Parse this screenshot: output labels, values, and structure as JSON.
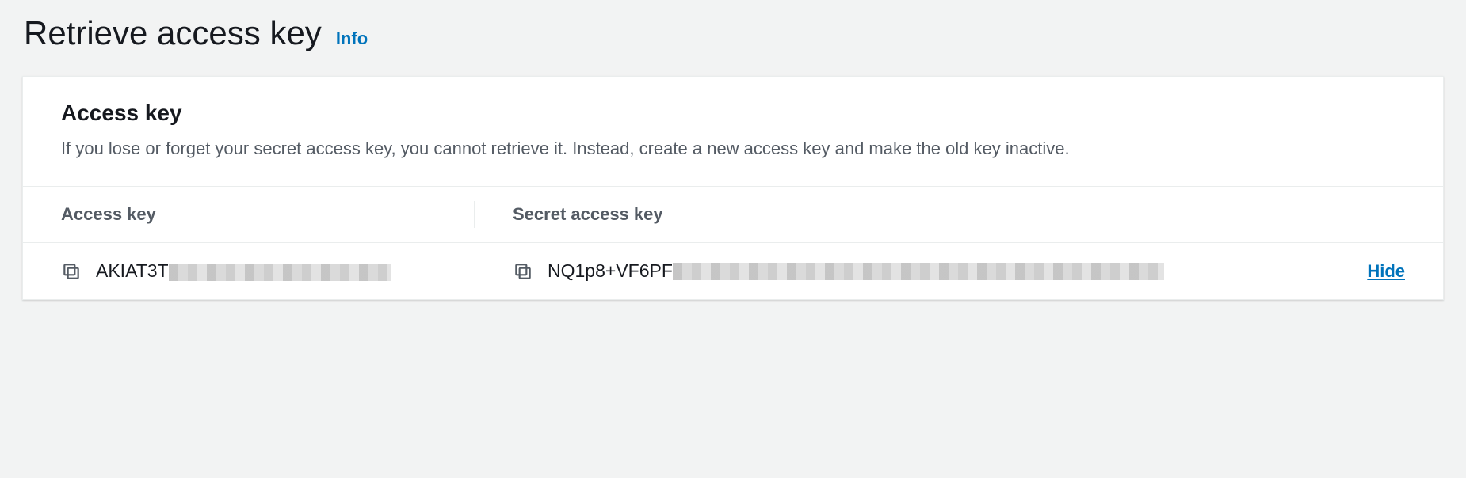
{
  "header": {
    "title": "Retrieve access key",
    "info_label": "Info"
  },
  "panel": {
    "title": "Access key",
    "description": "If you lose or forget your secret access key, you cannot retrieve it. Instead, create a new access key and make the old key inactive.",
    "columns": {
      "access_key": "Access key",
      "secret_key": "Secret access key"
    },
    "row": {
      "access_key_value": "AKIAT3T",
      "secret_key_value": "NQ1p8+VF6PF",
      "hide_label": "Hide"
    }
  }
}
